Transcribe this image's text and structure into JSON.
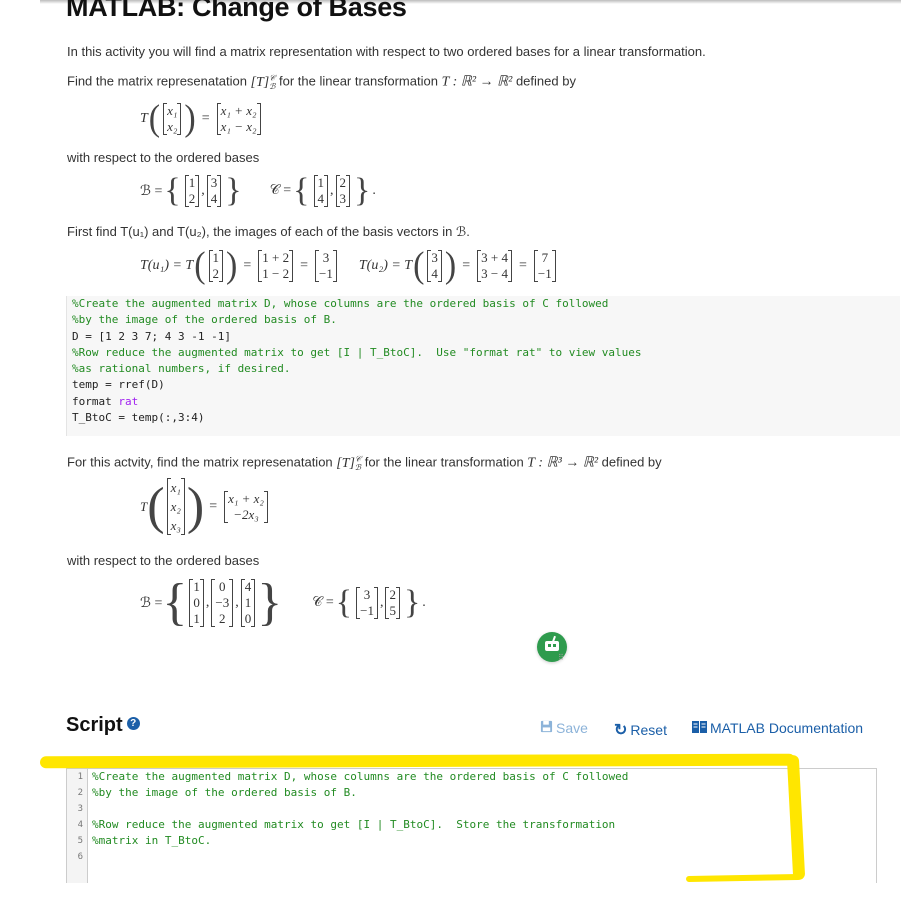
{
  "title": "MATLAB: Change of Bases",
  "intro": "In this activity you will find a matrix representation with respect to two ordered bases for a linear transformation.",
  "example": {
    "find_prefix": "Find the matrix represenatation ",
    "find_mid": " for the linear transformation ",
    "find_suffix": " defined by",
    "T_symbol": "T",
    "map": "T : ℝ² → ℝ²",
    "input_vector": [
      "x₁",
      "x₂"
    ],
    "output_vector": [
      "x₁ + x₂",
      "x₁ − x₂"
    ],
    "bases_label": "with respect to the ordered bases",
    "B_label": "ℬ =",
    "B_vectors": [
      [
        "1",
        "2"
      ],
      [
        "3",
        "4"
      ]
    ],
    "C_label": "𝒞 =",
    "C_vectors": [
      [
        "1",
        "4"
      ],
      [
        "2",
        "3"
      ]
    ],
    "images_text": "First find T(u₁) and T(u₂), the images of each of the basis vectors in ℬ.",
    "Tu1_label": "T(u₁) = T",
    "Tu1_arg": [
      "1",
      "2"
    ],
    "Tu1_expr": [
      "1 + 2",
      "1 − 2"
    ],
    "Tu1_result": [
      "3",
      "−1"
    ],
    "Tu2_label": "T(u₂) = T",
    "Tu2_arg": [
      "3",
      "4"
    ],
    "Tu2_expr": [
      "3 + 4",
      "3 − 4"
    ],
    "Tu2_result": [
      "7",
      "−1"
    ]
  },
  "example_code": [
    {
      "type": "comment",
      "text": "%Create the augmented matrix D, whose columns are the ordered basis of C followed"
    },
    {
      "type": "comment",
      "text": "%by the image of the ordered basis of B."
    },
    {
      "type": "plain",
      "text": "D = [1 2 3 7; 4 3 -1 -1]"
    },
    {
      "type": "comment",
      "text": "%Row reduce the augmented matrix to get [I | T_BtoC].  Use \"format rat\" to view values"
    },
    {
      "type": "comment",
      "text": "%as rational numbers, if desired."
    },
    {
      "type": "plain",
      "text": "temp = rref(D)"
    },
    {
      "type": "format",
      "text": "format ",
      "kw": "rat"
    },
    {
      "type": "plain",
      "text": "T_BtoC = temp(:,3:4)"
    }
  ],
  "activity": {
    "prefix": "For this actvity, find the matrix represenatation ",
    "mid": " for the linear transformation ",
    "map": "T : ℝ³ → ℝ²",
    "suffix": " defined by",
    "input_vector": [
      "x₁",
      "x₂",
      "x₃"
    ],
    "output_vector": [
      "x₁ + x₂",
      "−2x₃"
    ],
    "bases_label": "with respect to the ordered bases",
    "B_label": "ℬ =",
    "B_vectors": [
      [
        "1",
        "0",
        "1"
      ],
      [
        "0",
        "−3",
        "2"
      ],
      [
        "4",
        "1",
        "0"
      ]
    ],
    "C_label": "𝒞 =",
    "C_vectors": [
      [
        "3",
        "−1"
      ],
      [
        "2",
        "5"
      ]
    ]
  },
  "matrix_symbol": "[T]",
  "script": {
    "title": "Script",
    "help_icon": "?",
    "save_label": "Save",
    "reset_label": "Reset",
    "docs_label": "MATLAB Documentation",
    "line_numbers": [
      "1",
      "2",
      "3",
      "4",
      "5",
      "6"
    ],
    "lines": [
      "%Create the augmented matrix D, whose columns are the ordered basis of C followed",
      "%by the image of the ordered basis of B.",
      "",
      "%Row reduce the augmented matrix to get [I | T_BtoC].  Store the transformation",
      "%matrix in T_BtoC.",
      ""
    ]
  },
  "colors": {
    "comment": "#228b22",
    "keyword": "#a020f0",
    "link": "#1b5fa8",
    "save_disabled": "#8cb3d9",
    "highlight": "#ffe600",
    "bot": "#2e9b4d"
  }
}
